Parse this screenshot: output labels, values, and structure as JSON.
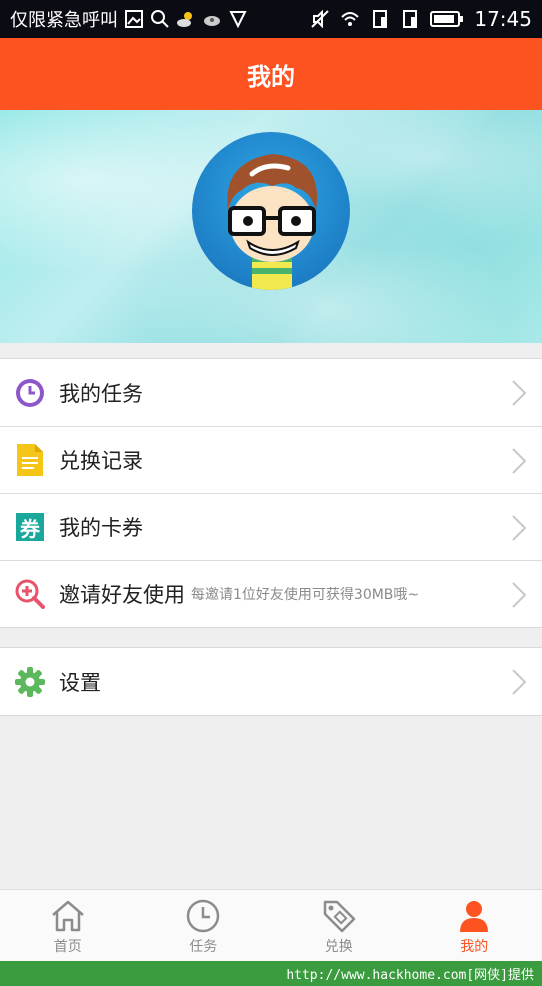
{
  "status_bar": {
    "carrier_text": "仅限紧急呼叫",
    "time": "17:45",
    "icons_left": [
      "image-icon",
      "search-icon",
      "weather-icon",
      "cloud-icon",
      "vpn-shield-icon"
    ],
    "icons_right": [
      "mute-icon",
      "wifi-icon",
      "sim-icon",
      "sim2-icon",
      "battery-icon"
    ]
  },
  "header": {
    "title": "我的"
  },
  "menu": {
    "items": [
      {
        "label": "我的任务",
        "icon": "clock-icon",
        "icon_color": "#8e57c9"
      },
      {
        "label": "兑换记录",
        "icon": "document-icon",
        "icon_color": "#f5c518"
      },
      {
        "label": "我的卡券",
        "icon": "coupon-icon",
        "icon_color": "#19a89b",
        "icon_text": "券"
      },
      {
        "label": "邀请好友使用",
        "sub": "每邀请1位好友使用可获得30MB哦~",
        "icon": "invite-search-icon",
        "icon_color": "#e8526a"
      }
    ],
    "settings": {
      "label": "设置",
      "icon": "gear-icon",
      "icon_color": "#5cb85c"
    }
  },
  "tabbar": {
    "tabs": [
      {
        "label": "首页",
        "icon": "home-icon"
      },
      {
        "label": "任务",
        "icon": "clock-icon"
      },
      {
        "label": "兑换",
        "icon": "tag-icon"
      },
      {
        "label": "我的",
        "icon": "person-icon",
        "active": true
      }
    ],
    "active_color": "#fd5321"
  },
  "footer": {
    "text": "http://www.hackhome.com[网侠]提供"
  }
}
